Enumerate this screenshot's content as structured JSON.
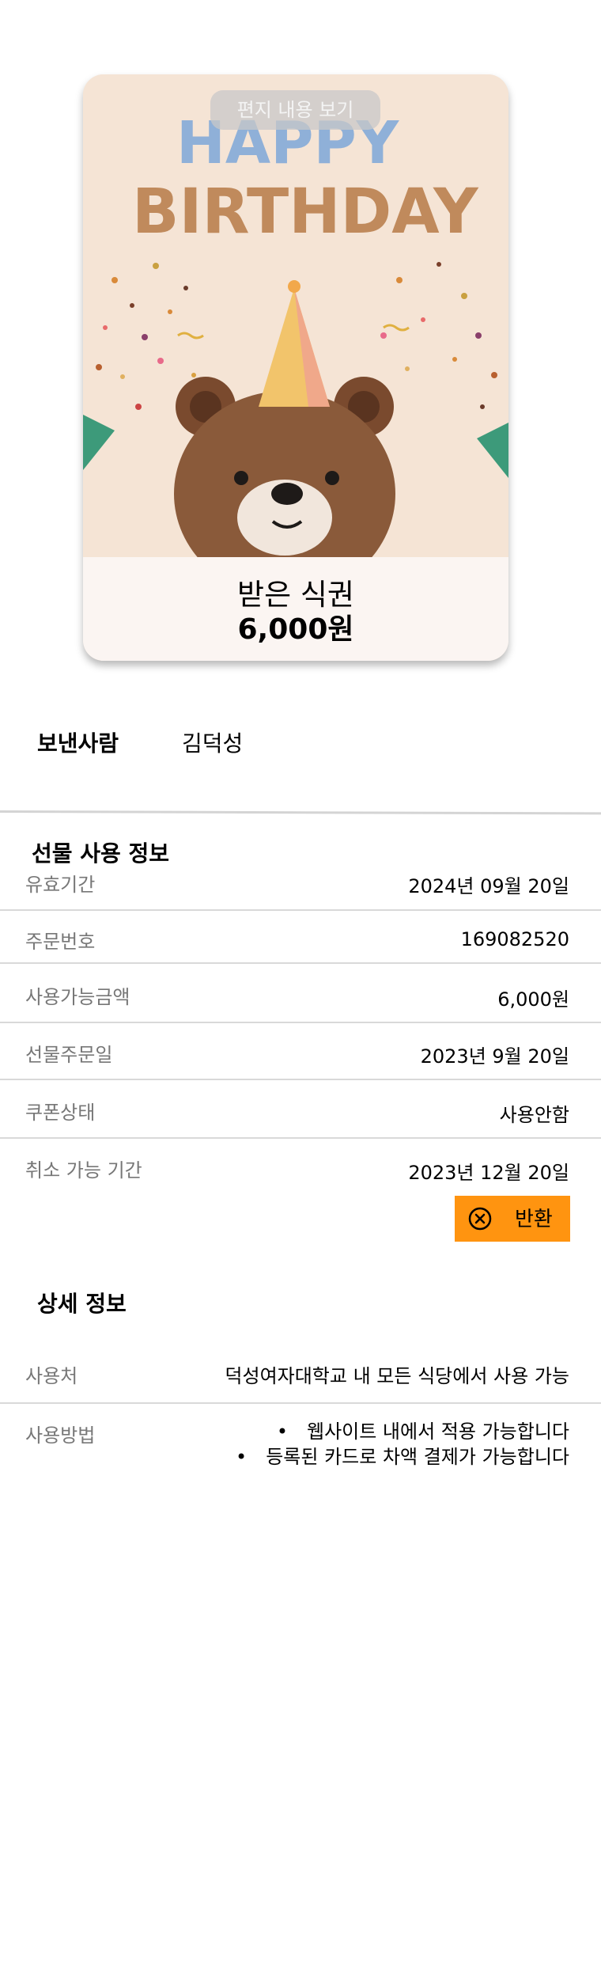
{
  "card": {
    "letter_button": "편지 내용 보기",
    "name": "받은 식권",
    "price": "6,000원",
    "artwork": "happy-birthday-bear-illustration",
    "artwork_text": [
      "HAPPY",
      "BIRTHDAY"
    ]
  },
  "sender": {
    "label": "보낸사람",
    "value": "김덕성"
  },
  "gift_info": {
    "title": "선물 사용 정보",
    "rows": [
      {
        "label": "유효기간",
        "value": "2024년 09월 20일"
      },
      {
        "label": "주문번호",
        "value": "169082520"
      },
      {
        "label": "사용가능금액",
        "value": "6,000원"
      },
      {
        "label": "선물주문일",
        "value": "2023년 9월 20일"
      },
      {
        "label": "쿠폰상태",
        "value": "사용안함"
      },
      {
        "label": "취소 가능 기간",
        "value": "2023년 12월 20일"
      }
    ],
    "return_button": "반환",
    "return_icon": "circle-x-icon"
  },
  "details": {
    "title": "상세 정보",
    "place_label": "사용처",
    "place_value": "덕성여자대학교 내 모든 식당에서 사용 가능",
    "method_label": "사용방법",
    "methods": [
      "웹사이트 내에서 적용 가능합니다",
      "등록된 카드로 차액 결제가 가능합니다"
    ]
  },
  "colors": {
    "accent": "#ff9410",
    "card_bg": "#f5e4d5"
  }
}
